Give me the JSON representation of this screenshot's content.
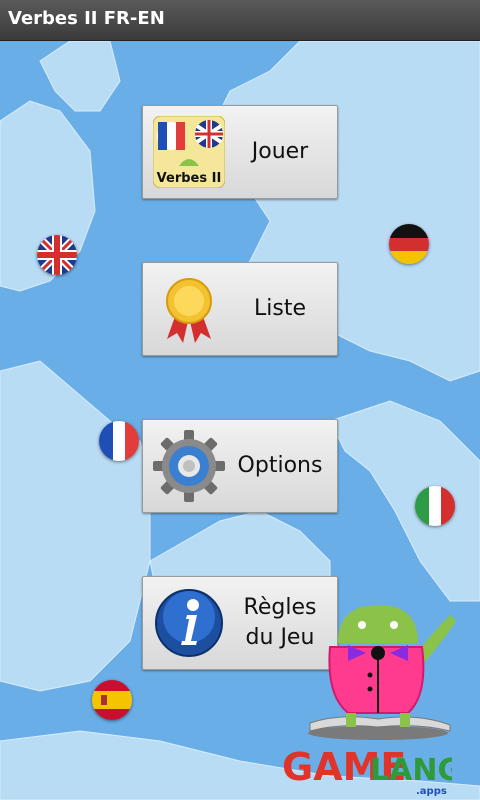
{
  "app": {
    "title": "Verbes II FR-EN"
  },
  "menu": [
    {
      "label": "Jouer",
      "icon": "verbes-ii-app-icon",
      "icon_text": "Verbes II"
    },
    {
      "label": "Liste",
      "icon": "award-ribbon-icon"
    },
    {
      "label": "Options",
      "icon": "settings-gear-icon"
    },
    {
      "label": "Règles\ndu Jeu",
      "icon": "info-icon"
    }
  ],
  "flags": [
    "uk-flag-icon",
    "germany-flag-icon",
    "france-flag-icon",
    "italy-flag-icon",
    "spain-flag-icon"
  ],
  "brand": {
    "word1": "GAME",
    "word2": "LANG",
    "sub": ".apps"
  },
  "colors": {
    "sea": "#6aaee8",
    "land": "#b9dcf5",
    "title_bar": "#404040",
    "brand_red": "#e0342b",
    "brand_green": "#2f9a3a"
  }
}
